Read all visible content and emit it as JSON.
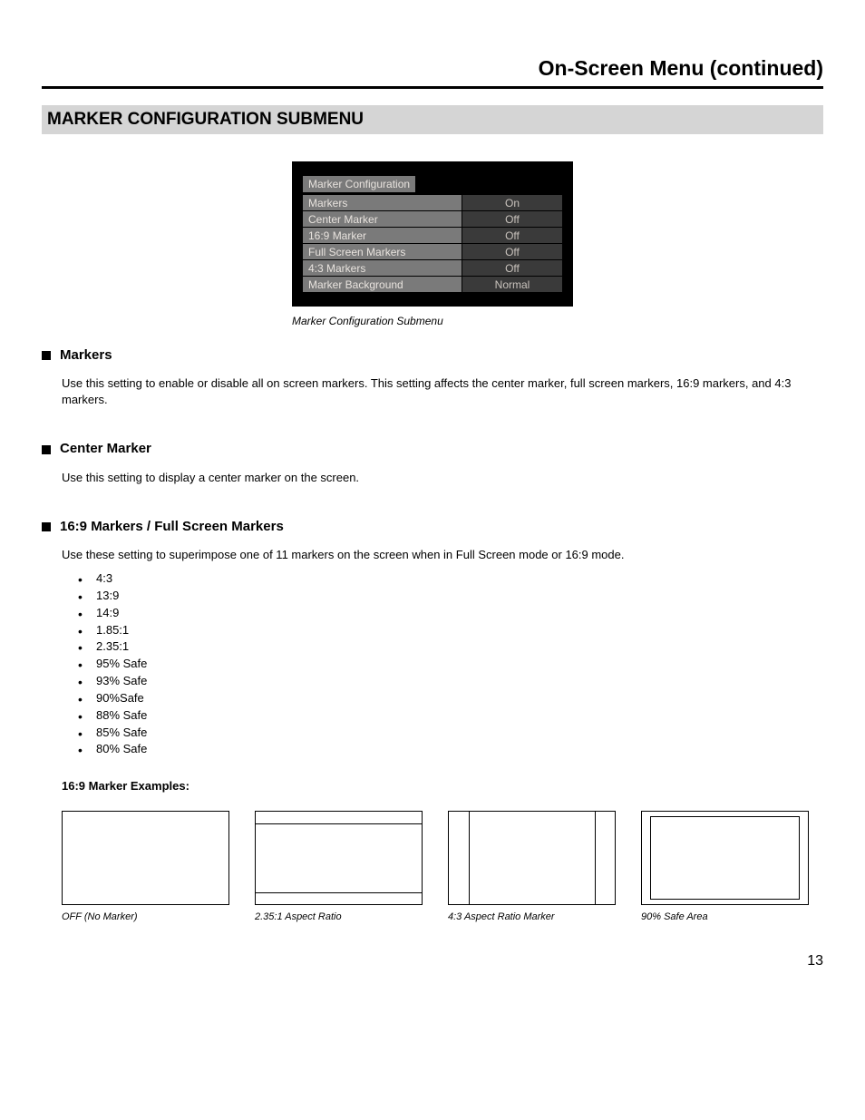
{
  "header": "On-Screen Menu (continued)",
  "sectionBar": "MARKER CONFIGURATION SUBMENU",
  "submenu": {
    "title": "Marker Configuration",
    "rows": [
      {
        "label": "Markers",
        "value": "On"
      },
      {
        "label": "Center Marker",
        "value": "Off"
      },
      {
        "label": "16:9 Marker",
        "value": "Off"
      },
      {
        "label": "Full Screen Markers",
        "value": "Off"
      },
      {
        "label": "4:3 Markers",
        "value": "Off"
      },
      {
        "label": "Marker Background",
        "value": "Normal"
      }
    ],
    "caption": "Marker Configuration Submenu"
  },
  "sections": {
    "markers": {
      "title": "Markers",
      "body": "Use this setting to enable or disable all on screen markers. This setting affects the center marker, full screen markers, 16:9 markers, and 4:3 markers."
    },
    "center": {
      "title": "Center Marker",
      "body": "Use this setting to display a center marker on the screen."
    },
    "sixteenNine": {
      "title": "16:9 Markers / Full Screen Markers",
      "body": "Use these setting to superimpose one of 11 markers on the screen when in Full Screen mode or 16:9 mode.",
      "options": [
        "4:3",
        "13:9",
        "14:9",
        "1.85:1",
        "2.35:1",
        "95% Safe",
        "93% Safe",
        "90%Safe",
        "88% Safe",
        "85% Safe",
        "80% Safe"
      ],
      "examplesHead": "16:9 Marker Examples:",
      "examples": [
        {
          "caption": "OFF (No Marker)"
        },
        {
          "caption": "2.35:1 Aspect Ratio"
        },
        {
          "caption": "4:3 Aspect Ratio Marker"
        },
        {
          "caption": "90% Safe Area"
        }
      ]
    }
  },
  "pageNumber": "13"
}
